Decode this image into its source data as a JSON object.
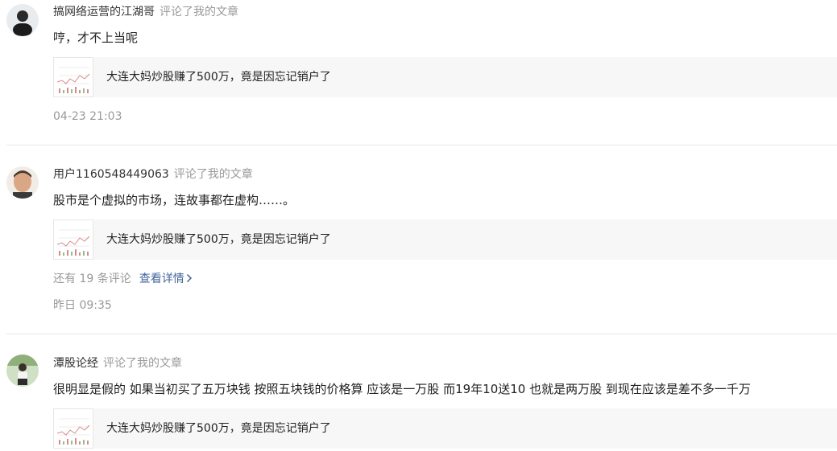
{
  "notifications": [
    {
      "username": "搞网络运营的江湖哥",
      "action": "评论了我的文章",
      "comment": "哼，才不上当呢",
      "article_title": "大连大妈炒股赚了500万，竟是因忘记销户了",
      "timestamp": "04-23 21:03"
    },
    {
      "username": "用户1160548449063",
      "action": "评论了我的文章",
      "comment": "股市是个虚拟的市场，连故事都在虚构……。",
      "article_title": "大连大妈炒股赚了500万，竟是因忘记销户了",
      "more_comments": "还有 19 条评论",
      "view_detail": "查看详情",
      "timestamp": "昨日 09:35"
    },
    {
      "username": "潭股论经",
      "action": "评论了我的文章",
      "comment": "很明显是假的 如果当初买了五万块钱 按照五块钱的价格算 应该是一万股 而19年10送10 也就是两万股 到现在应该是差不多一千万",
      "article_title": "大连大妈炒股赚了500万，竟是因忘记销户了"
    }
  ],
  "colors": {
    "link": "#406599",
    "muted": "#999999",
    "card_bg": "#f7f7f7",
    "divider": "#e8e8e8"
  }
}
